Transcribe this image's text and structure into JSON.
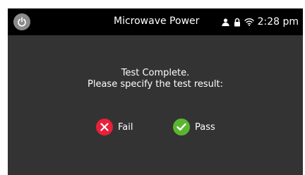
{
  "header": {
    "title": "Microwave Power",
    "time": "2:28 pm",
    "power_icon": "power-icon",
    "status_icons": [
      "user-icon",
      "lock-icon",
      "wifi-icon"
    ]
  },
  "dialog": {
    "line1": "Test Complete.",
    "line2": "Please specify the test result:",
    "fail": {
      "label": "Fail",
      "icon": "x-icon",
      "color": "#e8203a"
    },
    "pass": {
      "label": "Pass",
      "icon": "check-icon",
      "color": "#5cb531"
    }
  },
  "colors": {
    "background": "#333333",
    "topbar": "#000000",
    "text": "#ffffff",
    "power_button": "#8a8a8a"
  }
}
